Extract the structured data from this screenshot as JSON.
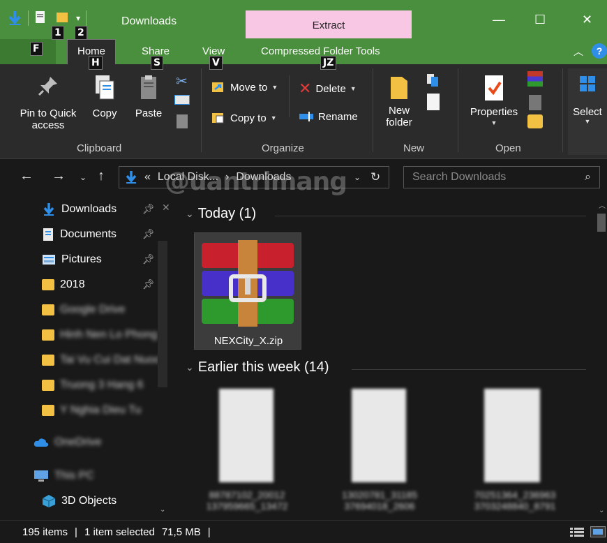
{
  "window": {
    "title": "Downloads",
    "contextual_tab": "Extract",
    "minimize": "—",
    "maximize": "☐",
    "close": "✕"
  },
  "keytips": {
    "qat1": "1",
    "qat2": "2",
    "file": "F",
    "home": "H",
    "share": "S",
    "view": "V",
    "compressed": "JZ"
  },
  "tabs": {
    "home": "Home",
    "share": "Share",
    "view": "View",
    "compressed": "Compressed Folder Tools"
  },
  "ribbon": {
    "clipboard": {
      "pin_label_1": "Pin to Quick",
      "pin_label_2": "access",
      "copy": "Copy",
      "paste": "Paste",
      "group": "Clipboard"
    },
    "organize": {
      "move_to": "Move to",
      "copy_to": "Copy to",
      "delete": "Delete",
      "rename": "Rename",
      "group": "Organize"
    },
    "new": {
      "new_folder_1": "New",
      "new_folder_2": "folder",
      "group": "New"
    },
    "open": {
      "properties": "Properties",
      "group": "Open"
    },
    "select": {
      "label": "Select"
    }
  },
  "address": {
    "crumb_prefix": "«",
    "crumb_1": "Local Disk...",
    "sep": "›",
    "crumb_2": "Downloads"
  },
  "search": {
    "placeholder": "Search Downloads"
  },
  "watermark": "@uantrimang",
  "nav": {
    "items": [
      {
        "label": "Downloads"
      },
      {
        "label": "Documents"
      },
      {
        "label": "Pictures"
      },
      {
        "label": "2018"
      },
      {
        "label": "Google Drive"
      },
      {
        "label": "Hinh Nen Lo Phong"
      },
      {
        "label": "Tai Vu Cui Dat Nuoc"
      },
      {
        "label": "Truong 3 Hang 6"
      },
      {
        "label": "Y Nghia Dieu Tu"
      },
      {
        "label": "OneDrive"
      },
      {
        "label": "This PC"
      },
      {
        "label": "3D Objects"
      }
    ]
  },
  "content": {
    "group_today": "Today (1)",
    "group_earlier": "Earlier this week (14)",
    "file_zip": "NEXCity_X.zip",
    "thumb_names": [
      {
        "l1": "88787102_20012",
        "l2": "137959665_13472"
      },
      {
        "l1": "13020781_31185",
        "l2": "37694018_2606"
      },
      {
        "l1": "70251364_236963",
        "l2": "3703248840_8791"
      }
    ]
  },
  "status": {
    "items": "195 items",
    "sep1": "|",
    "selected": "1 item selected",
    "size": "71,5 MB",
    "sep2": "|"
  }
}
